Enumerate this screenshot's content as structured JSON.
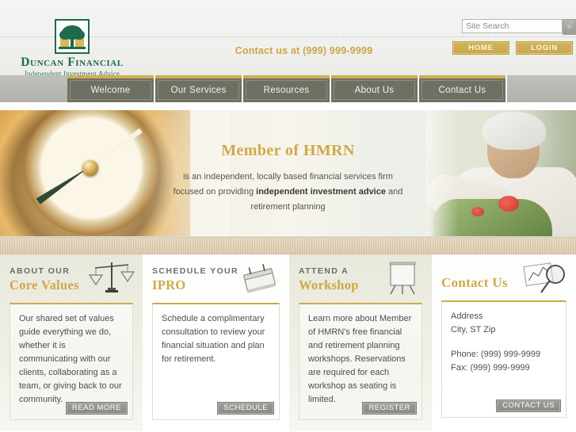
{
  "header": {
    "logo": {
      "mark_icon": "tree-emblem-icon",
      "name": "Duncan Financial",
      "tagline": "Independent Investment Advice"
    },
    "contact_line": "Contact us at (999) 999-9999",
    "search": {
      "placeholder": "Site Search",
      "value": "",
      "go_label": "»"
    },
    "buttons": [
      {
        "label": "HOME"
      },
      {
        "label": "LOGIN"
      }
    ]
  },
  "nav": {
    "items": [
      {
        "label": "Welcome"
      },
      {
        "label": "Our Services"
      },
      {
        "label": "Resources"
      },
      {
        "label": "About Us"
      },
      {
        "label": "Contact Us"
      }
    ]
  },
  "hero": {
    "title": "Member of HMRN",
    "line1": "is an independent, locally based financial services firm",
    "line2_pre": "focused on providing ",
    "line2_bold": "independent investment advice",
    "line2_post": " and",
    "line3": "retirement planning",
    "left_image": "compass-photo",
    "right_image": "senior-woman-gardening-photo"
  },
  "cards": [
    {
      "kicker": "ABOUT OUR",
      "title": "Core Values",
      "icon": "scales-of-justice-icon",
      "text": "Our shared set of values guide everything we do, whether it is communicating with our clients, collaborating as a team, or giving back to our community.",
      "button": "READ MORE"
    },
    {
      "kicker": "SCHEDULE YOUR",
      "title": "IPRO",
      "icon": "calendar-icon",
      "text": "Schedule a complimentary consultation to review your financial situation and plan for retirement.",
      "button": "SCHEDULE"
    },
    {
      "kicker": "ATTEND A",
      "title": "Workshop",
      "icon": "flipchart-easel-icon",
      "text": "Learn more about Member of HMRN's free financial and retirement planning workshops. Reservations are required for each workshop as seating is limited.",
      "button": "REGISTER"
    },
    {
      "kicker": "",
      "title": "Contact Us",
      "icon": "magnifier-chart-icon",
      "address_line1": "Address",
      "address_line2": "City, ST Zip",
      "phone": "Phone: (999) 999-9999",
      "fax": "Fax: (999) 999-9999",
      "button": "CONTACT US"
    }
  ],
  "colors": {
    "gold": "#cfa846",
    "nav_gray": "#6f7063",
    "logo_green": "#1d6b4a",
    "button_gray": "#8b8b85"
  }
}
